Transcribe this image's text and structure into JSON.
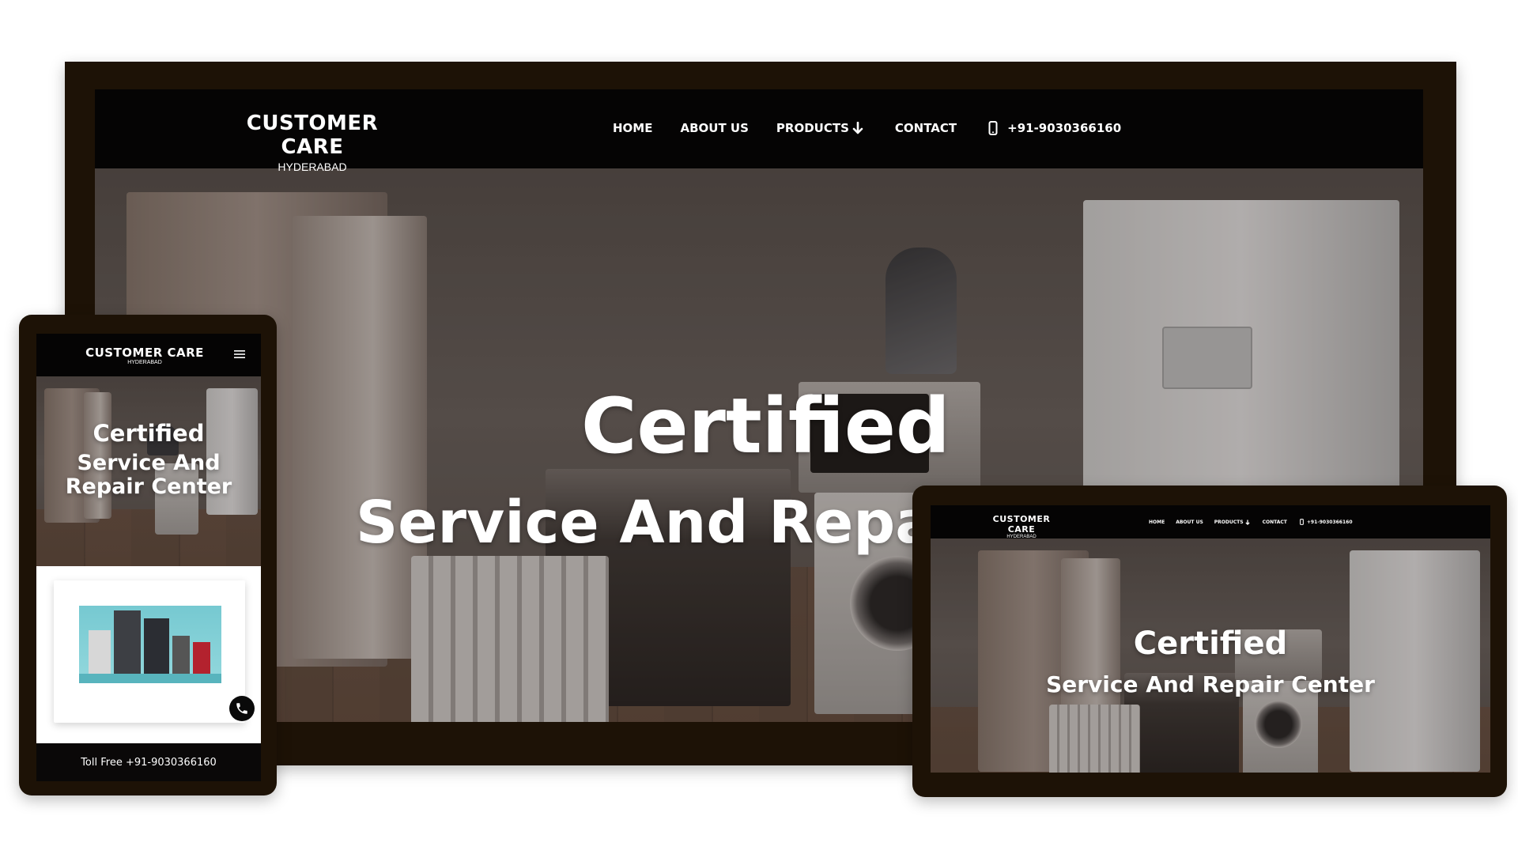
{
  "brand": {
    "title": "CUSTOMER CARE",
    "subtitle": "HYDERABAD"
  },
  "nav": {
    "items": [
      {
        "label": "HOME"
      },
      {
        "label": "ABOUT US"
      },
      {
        "label": "PRODUCTS"
      },
      {
        "label": "CONTACT"
      }
    ],
    "phone": "+91-9030366160"
  },
  "hero": {
    "heading": "Certified",
    "subheading_desktop": "Service And Repai",
    "subheading_full": "Service And Repair Center",
    "mobile_line1": "Certified",
    "mobile_line2": "Service And",
    "mobile_line3": "Repair Center"
  },
  "mobile": {
    "toll_free": "Toll Free +91-9030366160"
  },
  "icons": {
    "phone": "phone-icon",
    "arrow": "arrow-down-icon",
    "menu": "hamburger-menu-icon",
    "call": "call-button-icon"
  },
  "colors": {
    "frame": "#1d1206",
    "nav": "#050404",
    "text": "#ffffff"
  }
}
